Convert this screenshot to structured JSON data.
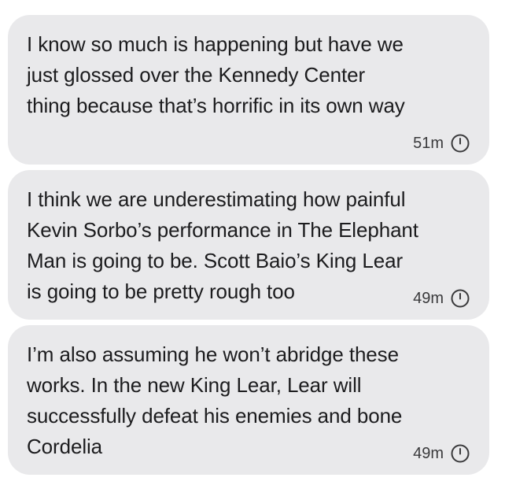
{
  "messages": [
    {
      "text": "I know so much is happening but have we\njust glossed over the Kennedy Center\nthing because that’s horrific in its own way",
      "time": "51m",
      "status_icon": "clock-icon"
    },
    {
      "text": "I think we are underestimating how painful\nKevin Sorbo’s performance in The Elephant\nMan is going to be. Scott Baio’s King Lear\nis going to be pretty rough too",
      "time": "49m",
      "status_icon": "clock-icon"
    },
    {
      "text": "I’m also assuming he won’t abridge these\nworks. In the new King Lear, Lear will\nsuccessfully defeat his enemies and bone\nCordelia",
      "time": "49m",
      "status_icon": "clock-icon"
    }
  ],
  "colors": {
    "bubble": "#e9e9eb",
    "text": "#1c1c1e",
    "meta": "#3a3a3c"
  }
}
